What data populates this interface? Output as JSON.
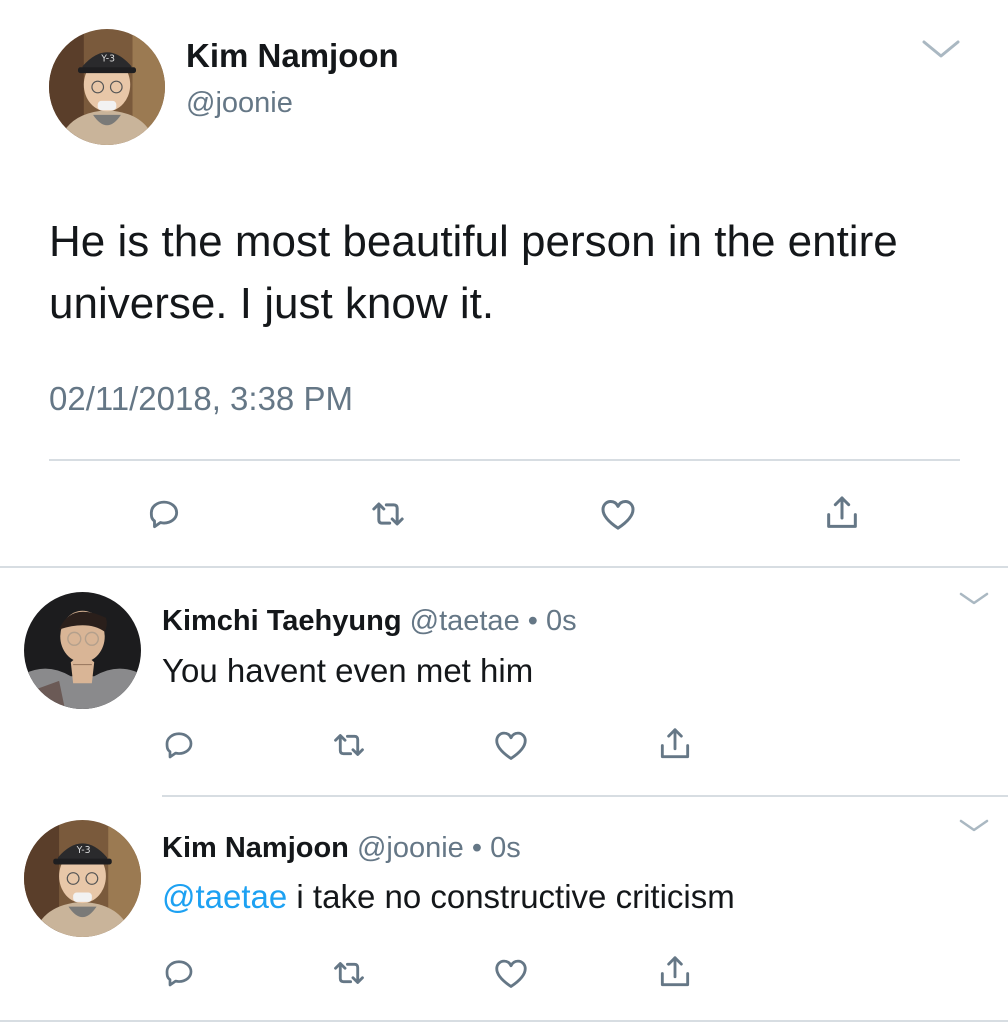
{
  "main_tweet": {
    "display_name": "Kim Namjoon",
    "handle": "@joonie",
    "text": "He is the most beautiful person in the entire universe. I just know it.",
    "timestamp": "02/11/2018, 3:38 PM",
    "icons": [
      "reply-icon",
      "retweet-icon",
      "like-icon",
      "share-icon"
    ]
  },
  "replies": [
    {
      "display_name": "Kimchi Taehyung",
      "handle": "@taetae",
      "separator": "•",
      "time": "0s",
      "mention": "",
      "text": "You havent even met him"
    },
    {
      "display_name": "Kim Namjoon",
      "handle": "@joonie",
      "separator": "•",
      "time": "0s",
      "mention": "@taetae",
      "text": "i take no constructive criticism"
    }
  ],
  "colors": {
    "text": "#14171a",
    "secondary": "#657786",
    "link": "#1da1f2",
    "divider": "#d7dde2",
    "background": "#ffffff"
  }
}
